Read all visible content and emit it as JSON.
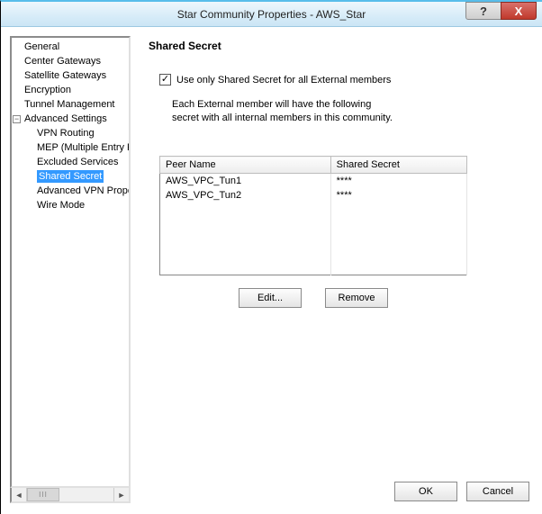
{
  "window": {
    "title": "Star Community Properties - AWS_Star",
    "help_btn": "?",
    "close_btn": "X"
  },
  "tree": {
    "items": [
      {
        "label": "General",
        "level": 0
      },
      {
        "label": "Center Gateways",
        "level": 0
      },
      {
        "label": "Satellite Gateways",
        "level": 0
      },
      {
        "label": "Encryption",
        "level": 0
      },
      {
        "label": "Tunnel Management",
        "level": 0
      },
      {
        "label": "Advanced Settings",
        "level": 0,
        "expander": "−"
      }
    ],
    "children": [
      {
        "label": "VPN Routing"
      },
      {
        "label": "MEP (Multiple Entry Point)"
      },
      {
        "label": "Excluded Services"
      },
      {
        "label": "Shared Secret",
        "selected": true
      },
      {
        "label": "Advanced VPN Properties"
      },
      {
        "label": "Wire Mode"
      }
    ],
    "scroll_thumb": "III"
  },
  "page": {
    "heading": "Shared Secret",
    "checkbox_checked": "✓",
    "checkbox_label": "Use only Shared Secret for all External members",
    "desc_line1": "Each External member will have the following",
    "desc_line2": "secret with all internal members in this community.",
    "grid": {
      "col1": "Peer Name",
      "col2": "Shared Secret",
      "rows": [
        {
          "name": "AWS_VPC_Tun1",
          "secret": "****"
        },
        {
          "name": "AWS_VPC_Tun2",
          "secret": "****"
        }
      ]
    },
    "edit_btn": "Edit...",
    "remove_btn": "Remove"
  },
  "dialog": {
    "ok": "OK",
    "cancel": "Cancel"
  }
}
